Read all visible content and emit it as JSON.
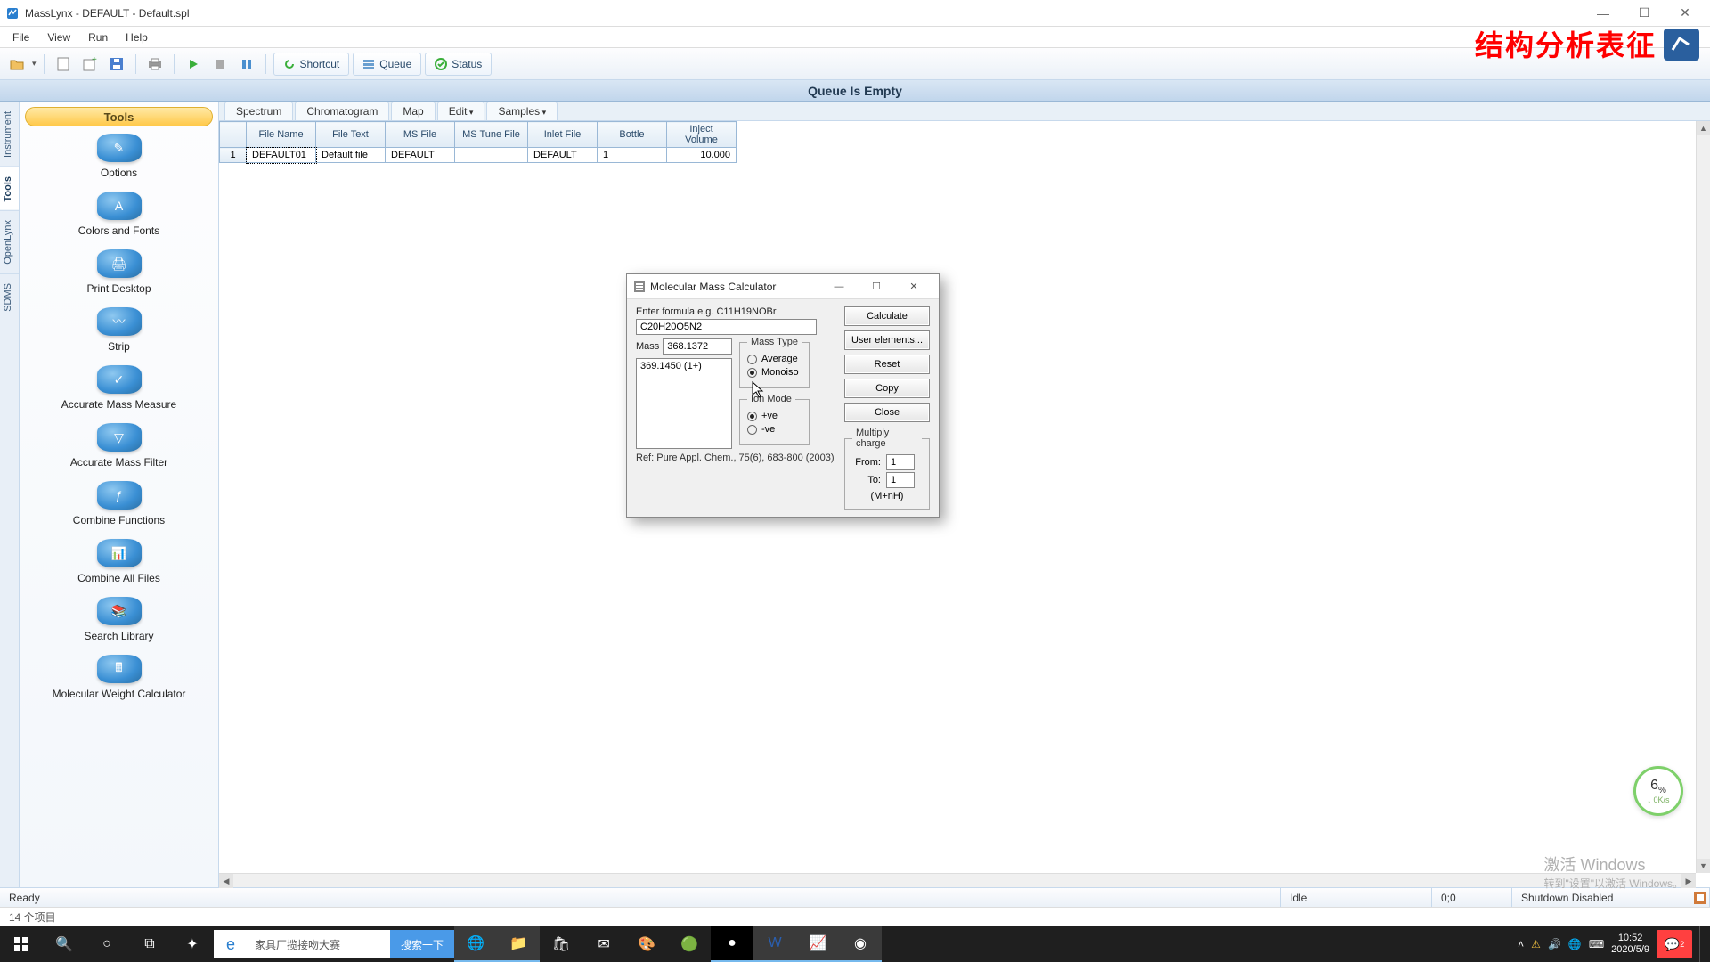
{
  "titlebar": {
    "title": "MassLynx - DEFAULT - Default.spl"
  },
  "menubar": [
    "File",
    "View",
    "Run",
    "Help"
  ],
  "watermark": "结构分析表征",
  "toolbar": {
    "chips": [
      {
        "label": "Shortcut"
      },
      {
        "label": "Queue"
      },
      {
        "label": "Status"
      }
    ]
  },
  "queue_banner": "Queue Is Empty",
  "vtabs": [
    "Instrument",
    "Tools",
    "OpenLynx",
    "SDMS"
  ],
  "tools_header": "Tools",
  "tools": [
    {
      "label": "Options"
    },
    {
      "label": "Colors and Fonts"
    },
    {
      "label": "Print Desktop"
    },
    {
      "label": "Strip"
    },
    {
      "label": "Accurate Mass Measure"
    },
    {
      "label": "Accurate Mass Filter"
    },
    {
      "label": "Combine Functions"
    },
    {
      "label": "Combine All Files"
    },
    {
      "label": "Search Library"
    },
    {
      "label": "Molecular Weight Calculator"
    }
  ],
  "tabs": [
    "Spectrum",
    "Chromatogram",
    "Map",
    "Edit",
    "Samples"
  ],
  "table": {
    "headers": [
      "",
      "File Name",
      "File Text",
      "MS File",
      "MS Tune File",
      "Inlet File",
      "Bottle",
      "Inject Volume"
    ],
    "row": {
      "n": "1",
      "file_name": "DEFAULT01",
      "file_text": "Default file",
      "ms_file": "DEFAULT",
      "ms_tune": "",
      "inlet": "DEFAULT",
      "bottle": "1",
      "inject": "10.000"
    }
  },
  "netbadge": {
    "val": "6",
    "unit": "%",
    "rate": "↓ 0K/s"
  },
  "activate": {
    "l1": "激活 Windows",
    "l2": "转到\"设置\"以激活 Windows。"
  },
  "status1": {
    "ready": "Ready",
    "idle": "Idle",
    "pos": "0;0",
    "shutdown": "Shutdown Disabled"
  },
  "status2": "14 个项目",
  "taskbar": {
    "search_placeholder": "家具厂揽接吻大赛",
    "search_btn": "搜索一下",
    "time": "10:52",
    "date": "2020/5/9"
  },
  "dialog": {
    "title": "Molecular Mass Calculator",
    "hint": "Enter formula e.g. C11H19NOBr",
    "formula": "C20H20O5N2",
    "mass_label": "Mass",
    "mass_value": "368.1372",
    "result": "369.1450 (1+)",
    "masstype": {
      "legend": "Mass Type",
      "avg": "Average",
      "mono": "Monoiso"
    },
    "ionmode": {
      "legend": "Ion Mode",
      "pos": "+ve",
      "neg": "-ve"
    },
    "multiply": {
      "legend": "Multiply charge",
      "from_label": "From:",
      "from": "1",
      "to_label": "To:",
      "to": "1",
      "mnh": "(M+nH)"
    },
    "buttons": {
      "calc": "Calculate",
      "user": "User elements...",
      "reset": "Reset",
      "copy": "Copy",
      "close": "Close"
    },
    "ref": "Ref: Pure Appl. Chem., 75(6), 683-800 (2003)"
  }
}
